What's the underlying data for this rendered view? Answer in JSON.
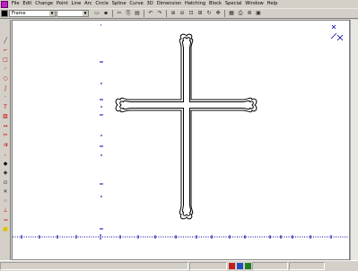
{
  "menubar": {
    "items": [
      "File",
      "Edit",
      "Change",
      "Point",
      "Line",
      "Arc",
      "Circle",
      "Spline",
      "Curve",
      "3D",
      "Dimension",
      "Hatching",
      "Block",
      "Special",
      "Window",
      "Help"
    ]
  },
  "toolbar": {
    "current_layer": "Frame",
    "buttons": [
      {
        "name": "new-icon",
        "glyph": "▭"
      },
      {
        "name": "save-icon",
        "glyph": "▪"
      },
      {
        "name": "cut-icon",
        "glyph": "✂"
      },
      {
        "name": "copy-icon",
        "glyph": "⎘"
      },
      {
        "name": "paste-icon",
        "glyph": "▤"
      },
      {
        "name": "undo-icon",
        "glyph": "↶"
      },
      {
        "name": "redo-icon",
        "glyph": "↷"
      },
      {
        "name": "zoom-in-icon",
        "glyph": "⊕"
      },
      {
        "name": "zoom-out-icon",
        "glyph": "⊖"
      },
      {
        "name": "zoom-window-icon",
        "glyph": "⊡"
      },
      {
        "name": "zoom-all-icon",
        "glyph": "⊞"
      },
      {
        "name": "redraw-icon",
        "glyph": "↻"
      },
      {
        "name": "pan-icon",
        "glyph": "✥"
      },
      {
        "name": "grid-icon",
        "glyph": "▦"
      },
      {
        "name": "print-icon",
        "glyph": "⎙"
      },
      {
        "name": "layer-manager-icon",
        "glyph": "≣"
      },
      {
        "name": "properties-icon",
        "glyph": "▣"
      }
    ]
  },
  "left_toolbox": {
    "tools": [
      {
        "name": "line-tool-icon",
        "glyph": "╱",
        "color": "#303030"
      },
      {
        "name": "polyline-tool-icon",
        "glyph": "⌐",
        "color": "#c00000"
      },
      {
        "name": "rectangle-tool-icon",
        "glyph": "□",
        "color": "#c00000"
      },
      {
        "name": "arc-tool-icon",
        "glyph": "◜",
        "color": "#c00000"
      },
      {
        "name": "circle-tool-icon",
        "glyph": "○",
        "color": "#c00000"
      },
      {
        "name": "spline-tool-icon",
        "glyph": "∫",
        "color": "#c00000"
      },
      {
        "name": "point-tool-icon",
        "glyph": "·",
        "color": "#303030"
      },
      {
        "name": "text-tool-icon",
        "glyph": "T",
        "color": "#c00000"
      },
      {
        "name": "hatch-tool-icon",
        "glyph": "▨",
        "color": "#c00000"
      },
      {
        "name": "dimension-tool-icon",
        "glyph": "↔",
        "color": "#c00000"
      },
      {
        "name": "trim-tool-icon",
        "glyph": "✂",
        "color": "#c00000"
      },
      {
        "name": "offset-tool-icon",
        "glyph": "⇉",
        "color": "#c00000"
      },
      {
        "name": "fillet-tool-icon",
        "glyph": "◟",
        "color": "#c00000"
      },
      {
        "name": "snap-endpoint-icon",
        "glyph": "◆",
        "color": "#000000"
      },
      {
        "name": "snap-midpoint-icon",
        "glyph": "◈",
        "color": "#000000"
      },
      {
        "name": "snap-center-icon",
        "glyph": "⊙",
        "color": "#303030"
      },
      {
        "name": "snap-intersection-icon",
        "glyph": "✕",
        "color": "#303030"
      },
      {
        "name": "snap-grid-icon",
        "glyph": "⁘",
        "color": "#303030"
      },
      {
        "name": "snap-perpendicular-icon",
        "glyph": "⊥",
        "color": "#c00000"
      },
      {
        "name": "snap-tangent-icon",
        "glyph": "⊸",
        "color": "#c00000"
      },
      {
        "name": "layer-color-icon",
        "glyph": "■",
        "color": "#e0c000"
      }
    ]
  },
  "canvas": {
    "background": "#ffffff",
    "ruler_color": "#0000a0",
    "shape_stroke": "#000000"
  },
  "statusbar": {
    "segments": [
      "",
      "",
      "",
      ""
    ]
  }
}
